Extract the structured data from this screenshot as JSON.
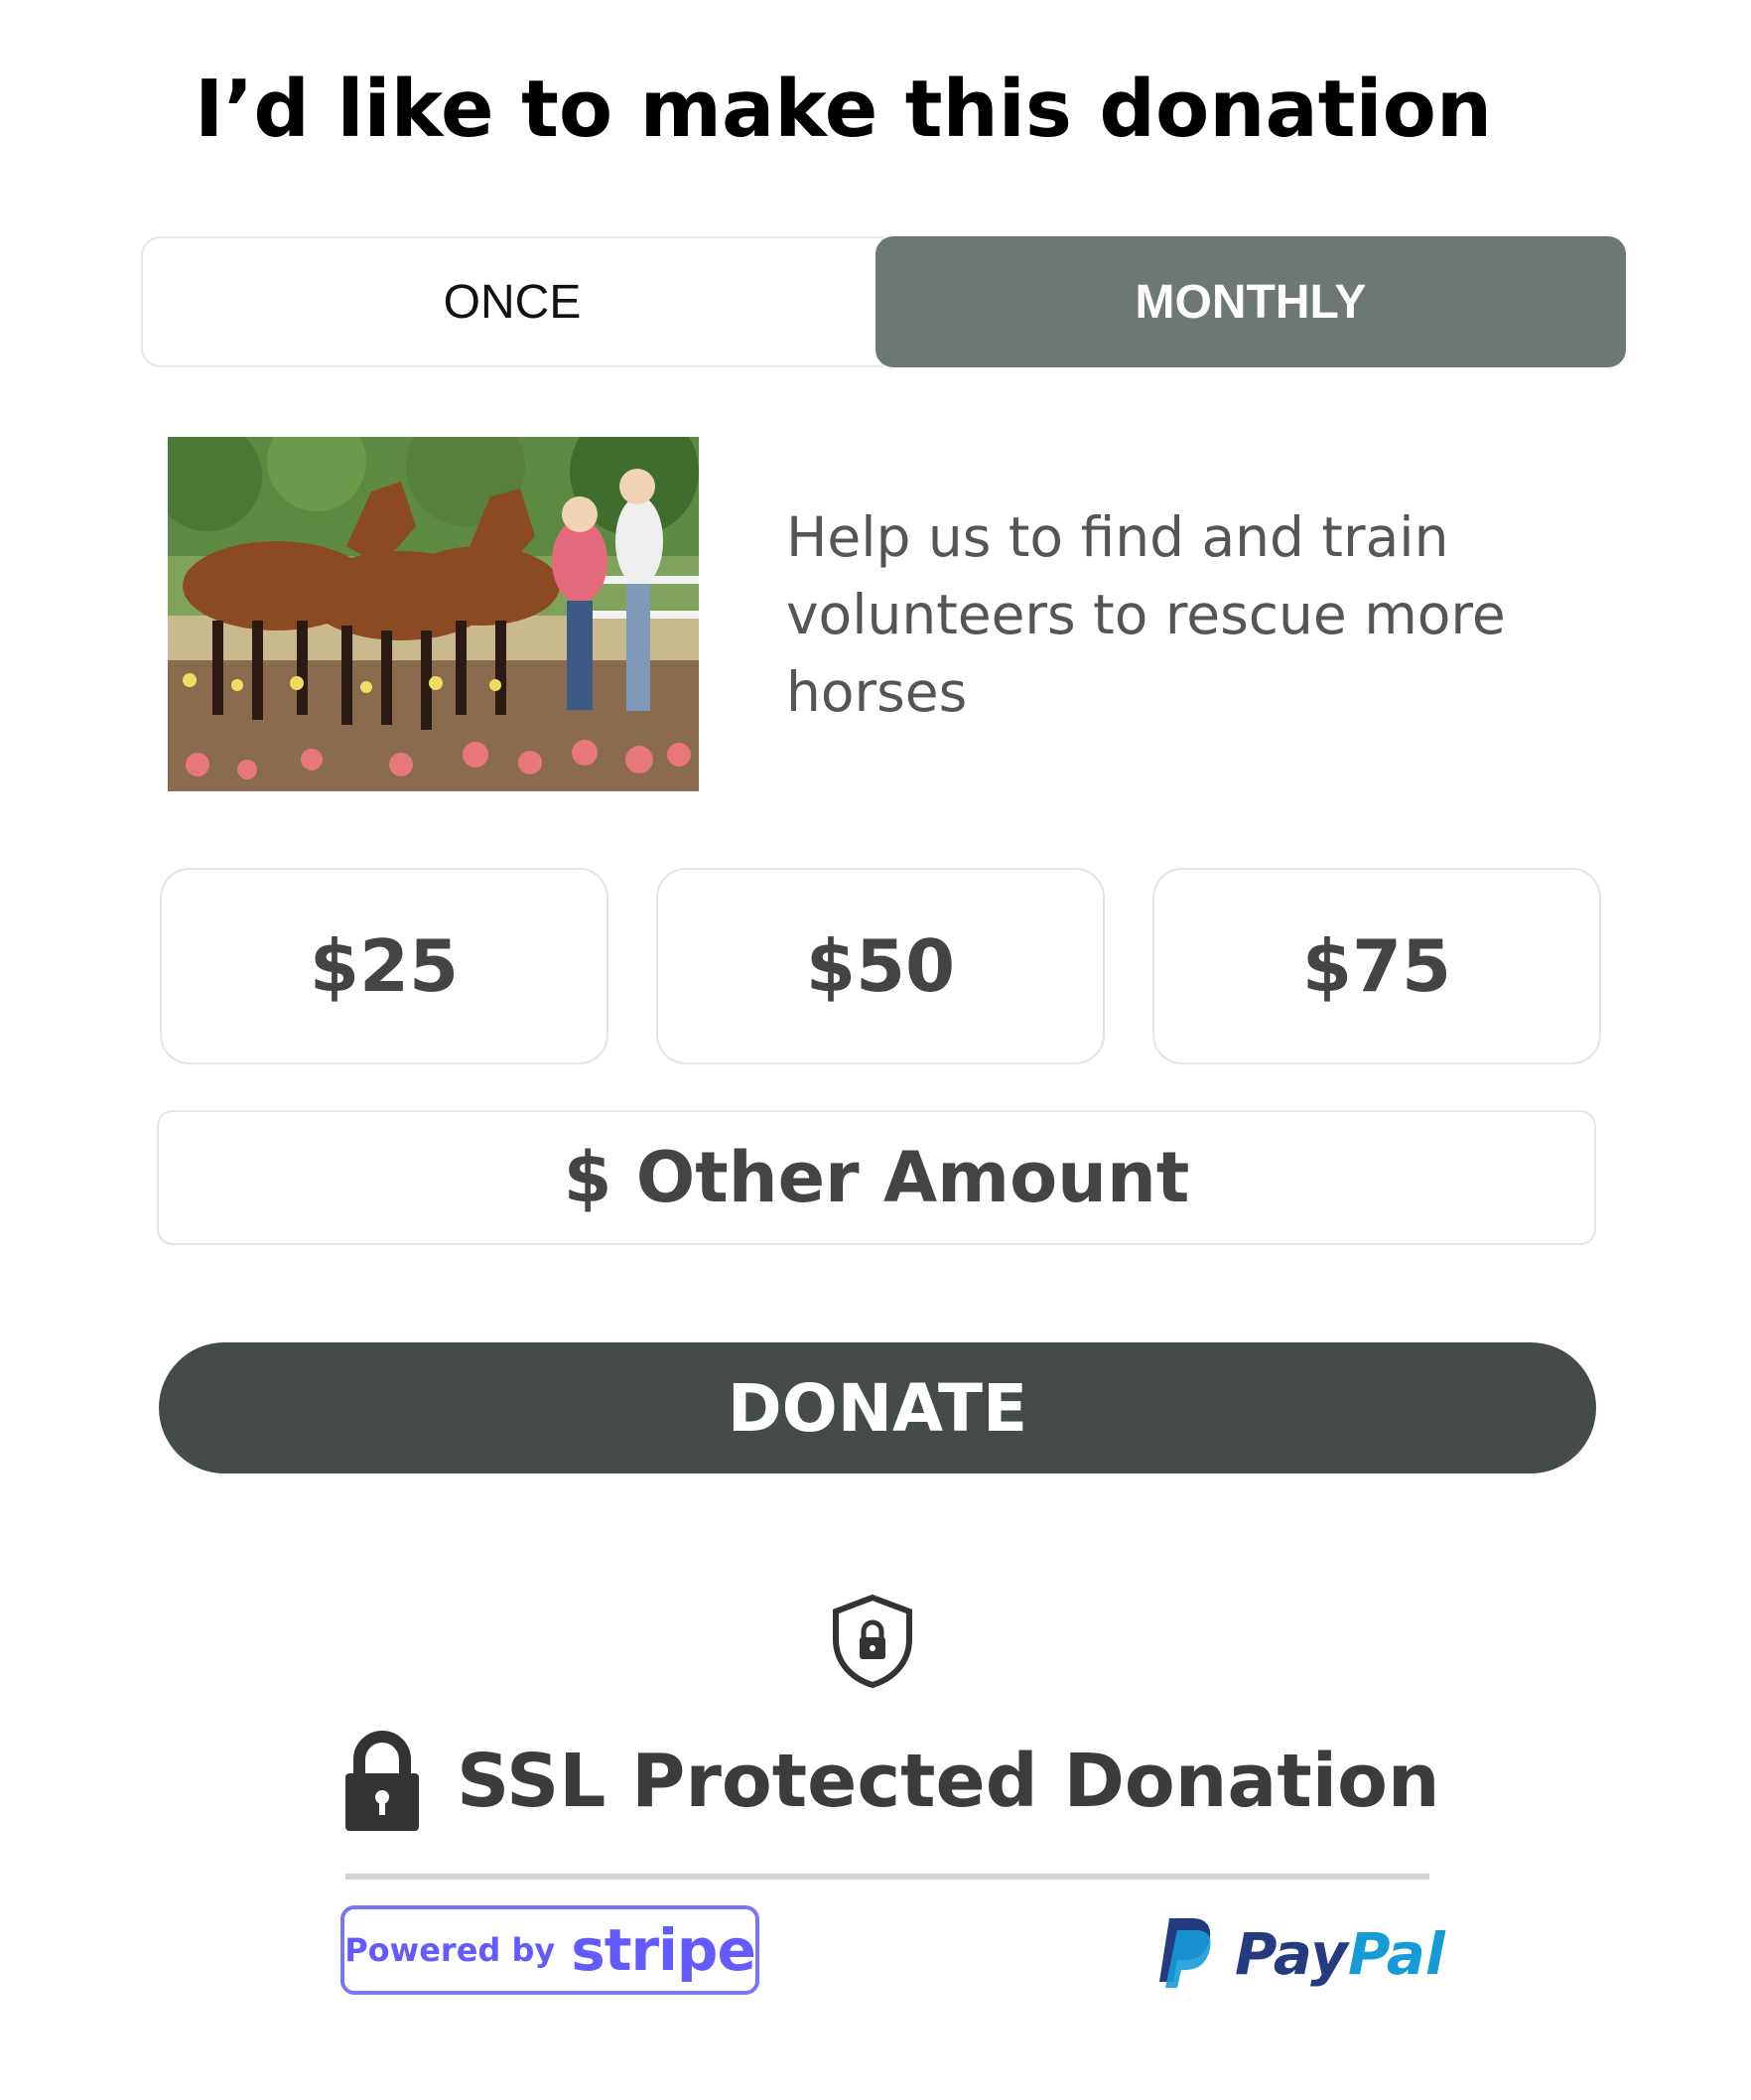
{
  "heading": "I’d like to make this donation",
  "frequency": {
    "options": [
      "ONCE",
      "MONTHLY"
    ],
    "selected": "MONTHLY"
  },
  "cause": {
    "image": "horses-and-volunteers-photo",
    "text": "Help us to find and train volunteers to rescue more horses"
  },
  "amounts": [
    "$25",
    "$50",
    "$75"
  ],
  "other_amount": {
    "placeholder": "$ Other Amount",
    "value": ""
  },
  "donate_label": "DONATE",
  "security": {
    "shield_icon": "shield-lock-icon",
    "ssl_text": "SSL Protected Donation",
    "lock_icon": "padlock-icon"
  },
  "payment_providers": {
    "stripe": {
      "prefix": "Powered by",
      "brand": "stripe"
    },
    "paypal": {
      "pay": "Pay",
      "pal": "Pal"
    }
  },
  "colors": {
    "selected_tab": "#6e7872",
    "donate_button": "#454c47",
    "stripe": "#635bff",
    "paypal_dark": "#253b80",
    "paypal_light": "#179bd7"
  }
}
